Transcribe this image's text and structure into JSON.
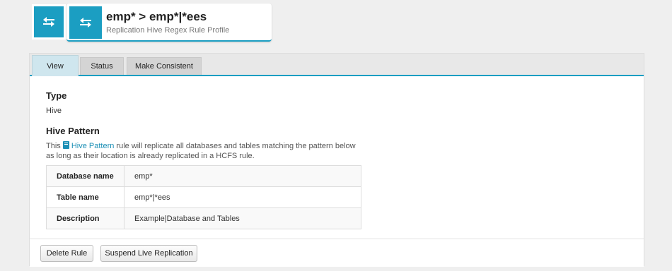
{
  "header": {
    "title": "emp* > emp*|*ees",
    "subtitle": "Replication Hive Regex Rule Profile",
    "icon": "transfer-arrows-icon",
    "accent": "#1b9ec2"
  },
  "tabs": [
    {
      "label": "View",
      "active": true
    },
    {
      "label": "Status",
      "active": false
    },
    {
      "label": "Make Consistent",
      "active": false
    }
  ],
  "type_section": {
    "heading": "Type",
    "value": "Hive"
  },
  "pattern_section": {
    "heading": "Hive Pattern",
    "desc_prefix": "This ",
    "link_label": "Hive Pattern",
    "desc_suffix": " rule will replicate all databases and tables matching the pattern below as long as their location is already replicated in a HCFS rule.",
    "rows": [
      {
        "key": "Database name",
        "value": "emp*"
      },
      {
        "key": "Table name",
        "value": "emp*|*ees"
      },
      {
        "key": "Description",
        "value": "Example|Database and Tables"
      }
    ]
  },
  "actions": {
    "delete_label": "Delete Rule",
    "suspend_label": "Suspend Live Replication"
  }
}
